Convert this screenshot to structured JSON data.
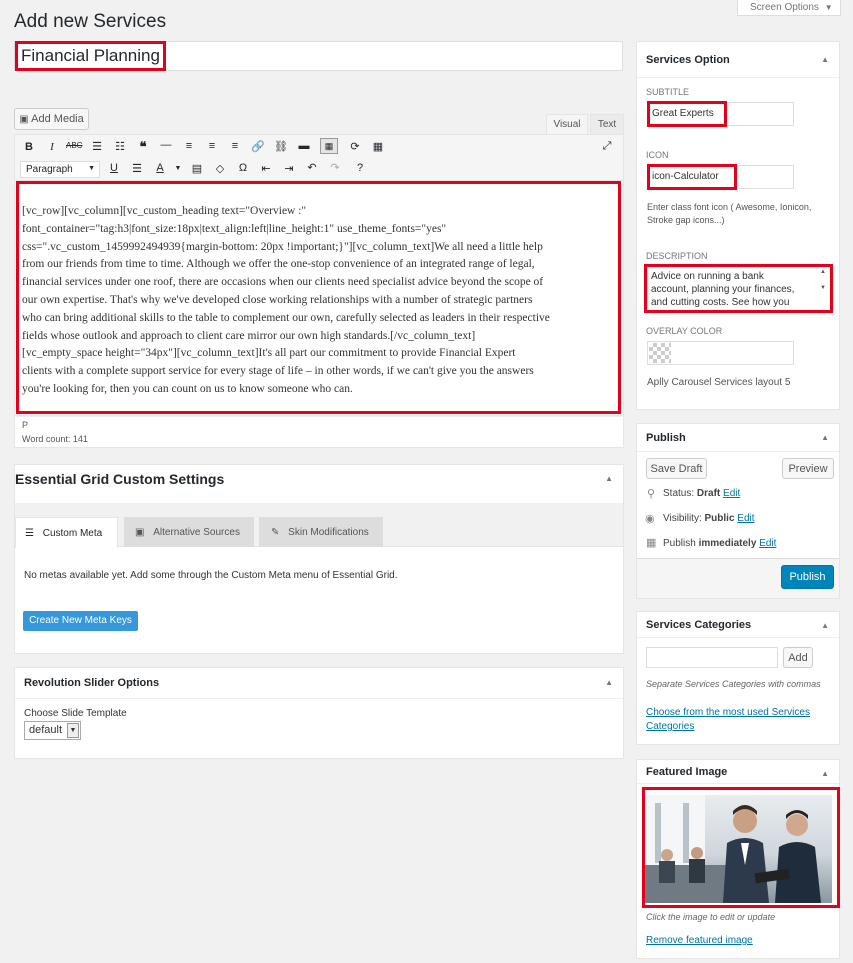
{
  "page": {
    "title": "Add new Services",
    "screen_options": "Screen Options"
  },
  "post": {
    "title_value": "Financial Planning"
  },
  "editor": {
    "add_media": "Add Media",
    "tab_visual": "Visual",
    "tab_text": "Text",
    "paragraph_select": "Paragraph",
    "content_lines": [
      "[vc_row][vc_column][vc_custom_heading text=\"Overview :\"",
      "font_container=\"tag:h3|font_size:18px|text_align:left|line_height:1\" use_theme_fonts=\"yes\"",
      "css=\".vc_custom_1459992494939{margin-bottom: 20px !important;}\"][vc_column_text]We all need a little help",
      "from our friends from time to time. Although we offer the one-stop convenience of an integrated range of legal,",
      "financial services under one roof, there are occasions when our clients need specialist advice beyond the scope of",
      "our own expertise. That's why we've developed close working relationships with a number of strategic partners",
      "who can bring additional skills to the table to complement our own, carefully selected as leaders in their respective",
      "fields whose outlook and approach to client care mirror our own high standards.[/vc_column_text]",
      "[vc_empty_space height=\"34px\"][vc_column_text]It's all part our commitment to provide Financial Expert",
      "clients with a complete support service for every stage of life – in other words, if we can't give you the answers",
      "you're looking for, then you can count on us to know someone who can."
    ],
    "path": "P",
    "word_count": "Word count: 141"
  },
  "essential_grid": {
    "title": "Essential Grid Custom Settings",
    "tabs": [
      "Custom Meta",
      "Alternative Sources",
      "Skin Modifications"
    ],
    "message": "No metas available yet. Add some through the Custom Meta menu of Essential Grid.",
    "create_button": "Create New Meta Keys"
  },
  "revslider": {
    "title": "Revolution Slider Options",
    "label": "Choose Slide Template",
    "select_value": "default"
  },
  "services_option": {
    "title": "Services Option",
    "subtitle_label": "SUBTITLE",
    "subtitle_value": "Great Experts",
    "icon_label": "ICON",
    "icon_value": "icon-Calculator",
    "icon_help": "Enter class font icon ( Awesome, Ionicon, Stroke gap icons...)",
    "description_label": "DESCRIPTION",
    "description_lines": [
      "Advice on running a bank",
      "account, planning your finances,",
      "and cutting costs. See how you"
    ],
    "overlay_label": "OVERLAY COLOR",
    "layout_note": "Aplly Carousel Services layout 5"
  },
  "publish": {
    "title": "Publish",
    "save_draft": "Save Draft",
    "preview": "Preview",
    "status_label": "Status:",
    "status_value": "Draft",
    "visibility_label": "Visibility:",
    "visibility_value": "Public",
    "publish_label": "Publish",
    "publish_value": "immediately",
    "edit": "Edit",
    "publish_button": "Publish"
  },
  "categories": {
    "title": "Services Categories",
    "add_button": "Add",
    "hint": "Separate Services Categories with commas",
    "most_used_lines": [
      "Choose from the most used Services",
      "Categories"
    ]
  },
  "featured": {
    "title": "Featured Image",
    "hint": "Click the image to edit or update",
    "remove": "Remove featured image"
  },
  "colors": {
    "highlight": "#e4001b",
    "primary_button": "#0085ba",
    "link": "#0073aa"
  }
}
